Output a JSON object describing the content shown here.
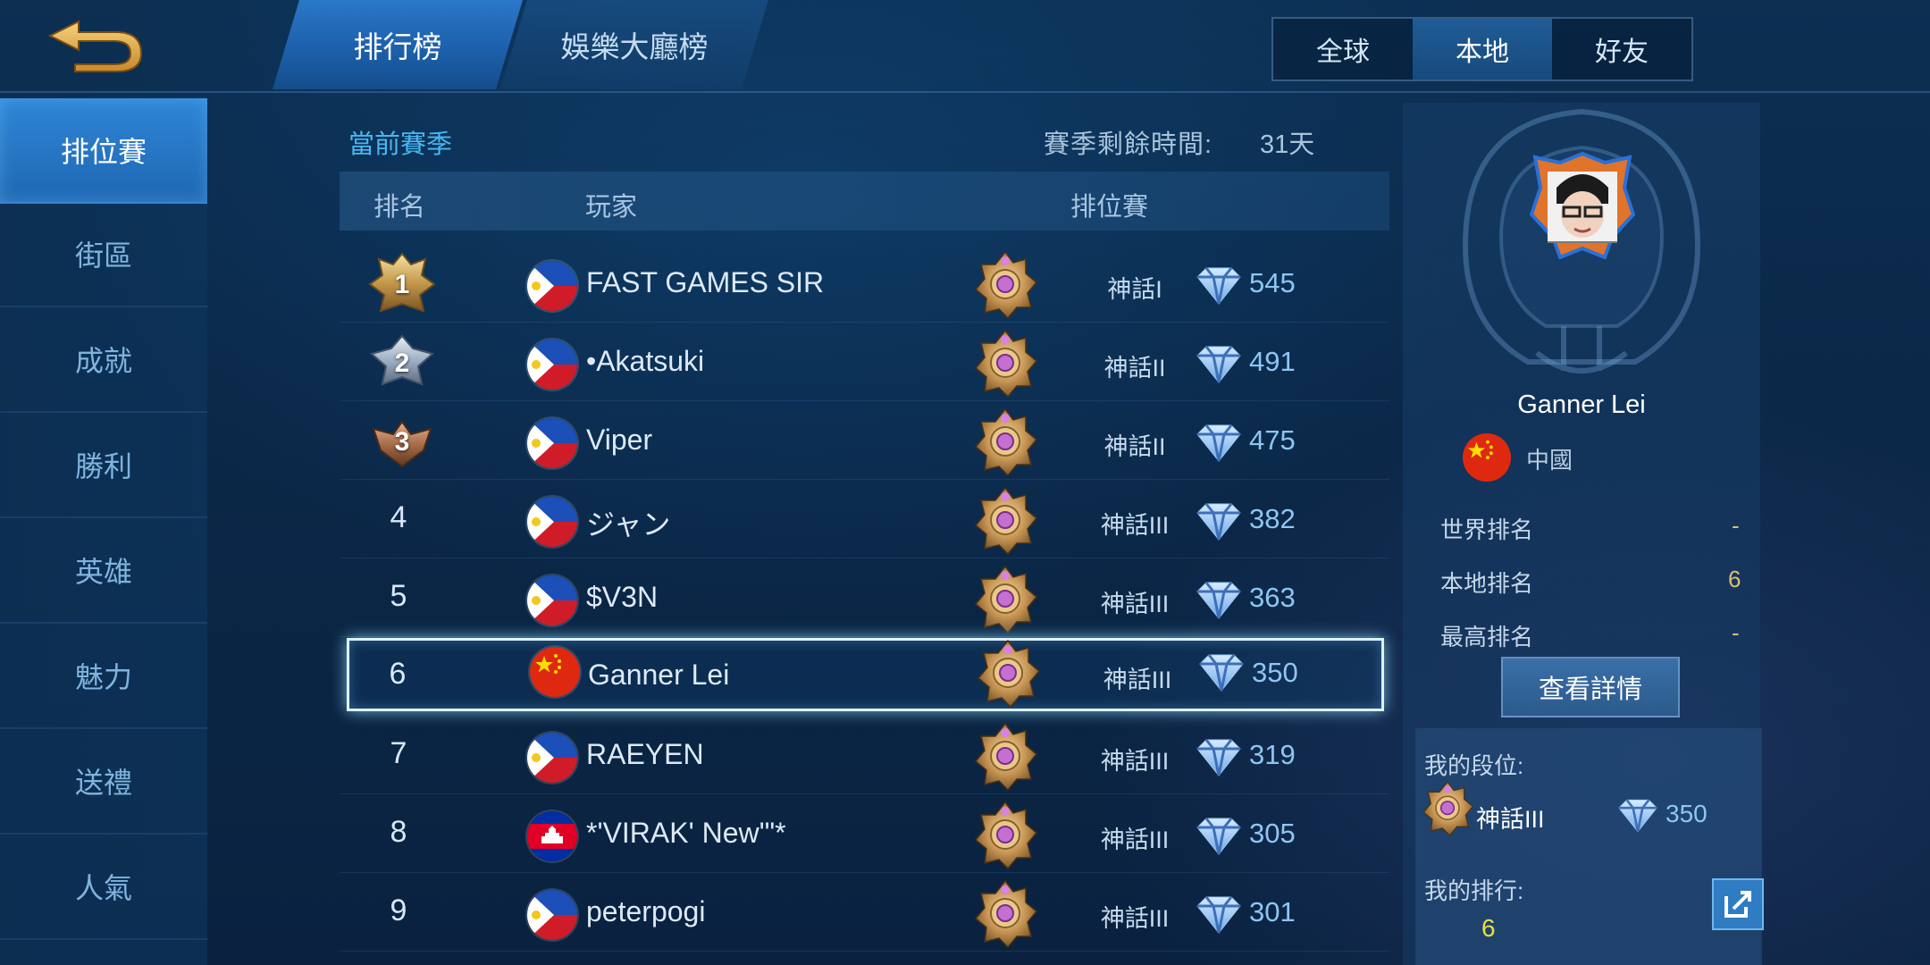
{
  "tabs": [
    {
      "label": "排行榜",
      "active": true
    },
    {
      "label": "娛樂大廳榜",
      "active": false
    }
  ],
  "scope": {
    "options": [
      "全球",
      "本地",
      "好友"
    ],
    "selected": "本地"
  },
  "sidebar": {
    "items": [
      {
        "label": "排位賽",
        "active": true
      },
      {
        "label": "街區"
      },
      {
        "label": "成就"
      },
      {
        "label": "勝利"
      },
      {
        "label": "英雄"
      },
      {
        "label": "魅力"
      },
      {
        "label": "送禮"
      },
      {
        "label": "人氣"
      }
    ]
  },
  "list": {
    "season_label": "當前賽季",
    "remaining_label": "賽季剩餘時間:",
    "remaining_value": "31天",
    "headers": {
      "rank": "排名",
      "player": "玩家",
      "ranked": "排位賽"
    },
    "rows": [
      {
        "rank": "1",
        "flag": "philippines",
        "name": "FAST GAMES SIR",
        "tier": "神話I",
        "points": "545"
      },
      {
        "rank": "2",
        "flag": "philippines",
        "name": "•Akatsuki",
        "tier": "神話II",
        "points": "491"
      },
      {
        "rank": "3",
        "flag": "philippines",
        "name": "Viper",
        "tier": "神話II",
        "points": "475"
      },
      {
        "rank": "4",
        "flag": "philippines",
        "name": "ジャン",
        "tier": "神話III",
        "points": "382"
      },
      {
        "rank": "5",
        "flag": "philippines",
        "name": "$V3N",
        "tier": "神話III",
        "points": "363"
      },
      {
        "rank": "6",
        "flag": "china",
        "name": "Ganner Lei",
        "tier": "神話III",
        "points": "350",
        "highlighted": true
      },
      {
        "rank": "7",
        "flag": "philippines",
        "name": "RAEYEN",
        "tier": "神話III",
        "points": "319"
      },
      {
        "rank": "8",
        "flag": "cambodia",
        "name": "*'VIRAK' New'\"*",
        "tier": "神話III",
        "points": "305"
      },
      {
        "rank": "9",
        "flag": "philippines",
        "name": "peterpogi",
        "tier": "神話III",
        "points": "301"
      }
    ]
  },
  "profile": {
    "name": "Ganner Lei",
    "country": "中國",
    "stats": [
      {
        "label": "世界排名",
        "value": "-"
      },
      {
        "label": "本地排名",
        "value": "6"
      },
      {
        "label": "最高排名",
        "value": "-"
      }
    ],
    "details_button": "查看詳情",
    "my_tier_label": "我的段位:",
    "my_tier": "神話III",
    "my_points": "350",
    "my_rank_label": "我的排行:",
    "my_rank": "6"
  },
  "colors": {
    "accent_blue": "#48b8f0",
    "active_tab": "#2a78c8",
    "gold_value": "#d8c070",
    "my_rank_yellow": "#e8e040"
  }
}
